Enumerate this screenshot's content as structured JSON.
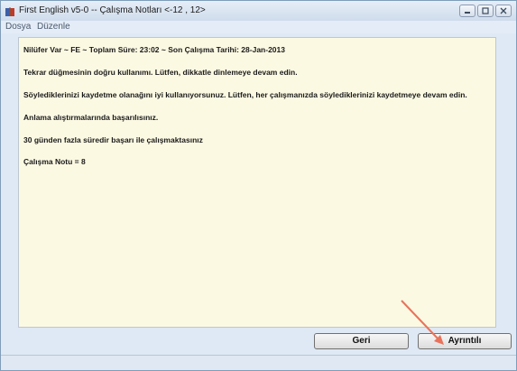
{
  "window": {
    "title": "First English v5-0  --  Çalışma Notları <-12 , 12>",
    "icon": "book-icon"
  },
  "menu": {
    "items": [
      "Dosya",
      "Düzenle"
    ]
  },
  "report": {
    "header": "Nilüfer Var  ~  FE  ~  Toplam Süre: 23:02  ~  Son Çalışma Tarihi: 28-Jan-2013",
    "lines": [
      "Tekrar düğmesinin doğru kullanımı. Lütfen, dikkatle dinlemeye devam edin.",
      "Söylediklerinizi kaydetme olanağını iyi kullanıyorsunuz. Lütfen, her çalışmanızda söylediklerinizi kaydetmeye devam edin.",
      "Anlama alıştırmalarında başarılısınız.",
      "30 günden fazla süredir başarı ile çalışmaktasınız",
      "Çalışma Notu = 8"
    ]
  },
  "buttons": {
    "back_label": "Geri",
    "details_label": "Ayrıntılı"
  },
  "colors": {
    "content_bg": "#fcf9e3",
    "annotation_arrow": "#e8735a"
  }
}
